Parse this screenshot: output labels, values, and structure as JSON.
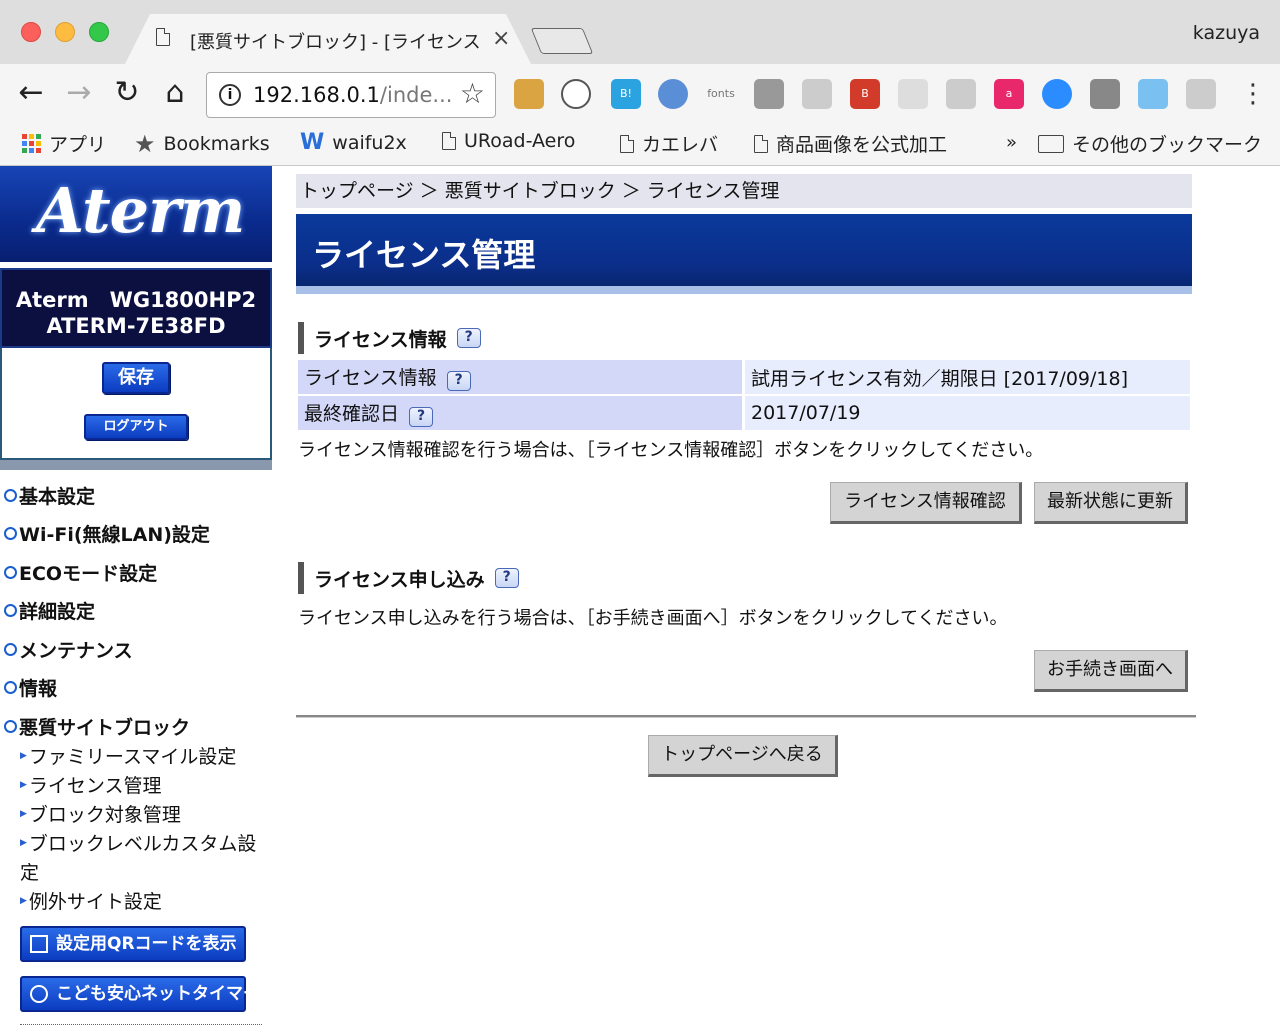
{
  "browser": {
    "tab_title": "[悪質サイトブロック] - [ライセンス",
    "profile_name": "kazuya",
    "url_host": "192.168.0.1",
    "url_rest": "/inde...",
    "ext_fonts_label": "fonts",
    "bookmarks": {
      "apps": "アプリ",
      "bookmarks": "Bookmarks",
      "waifu": "waifu2x",
      "uroad": "URoad-Aero",
      "kaereba": "カエレバ",
      "shohin": "商品画像を公式加工",
      "more": "»",
      "other": "その他のブックマーク"
    }
  },
  "sidebar": {
    "logo": "Aterm",
    "model_line1": "Aterm　WG1800HP2",
    "model_line2": "ATERM-7E38FD",
    "save": "保存",
    "logout": "ログアウト",
    "menu": {
      "basic": "基本設定",
      "wifi": "Wi-Fi(無線LAN)設定",
      "eco": "ECOモード設定",
      "detail": "詳細設定",
      "maint": "メンテナンス",
      "info": "情報",
      "malicious": "悪質サイトブロック"
    },
    "sub": {
      "family": "ファミリースマイル設定",
      "license": "ライセンス管理",
      "block_target": "ブロック対象管理",
      "block_level": "ブロックレベルカスタム設定",
      "exception": "例外サイト設定"
    },
    "qr_button": "設定用QRコードを表示",
    "timer_button": "こども安心ネットタイマー"
  },
  "main": {
    "breadcrumb": "トップページ ＞ 悪質サイトブロック ＞ ライセンス管理",
    "title": "ライセンス管理",
    "section1": "ライセンス情報",
    "table": {
      "row1_label": "ライセンス情報",
      "row1_value": "試用ライセンス有効／期限日 [2017/09/18]",
      "row2_label": "最終確認日",
      "row2_value": "2017/07/19"
    },
    "text1": "ライセンス情報確認を行う場合は、［ライセンス情報確認］ボタンをクリックしてください。",
    "btn_check": "ライセンス情報確認",
    "btn_refresh": "最新状態に更新",
    "section2": "ライセンス申し込み",
    "text2": "ライセンス申し込みを行う場合は、［お手続き画面へ］ボタンをクリックしてください。",
    "btn_procedure": "お手続き画面へ",
    "btn_top": "トップページへ戻る",
    "help": "?"
  }
}
